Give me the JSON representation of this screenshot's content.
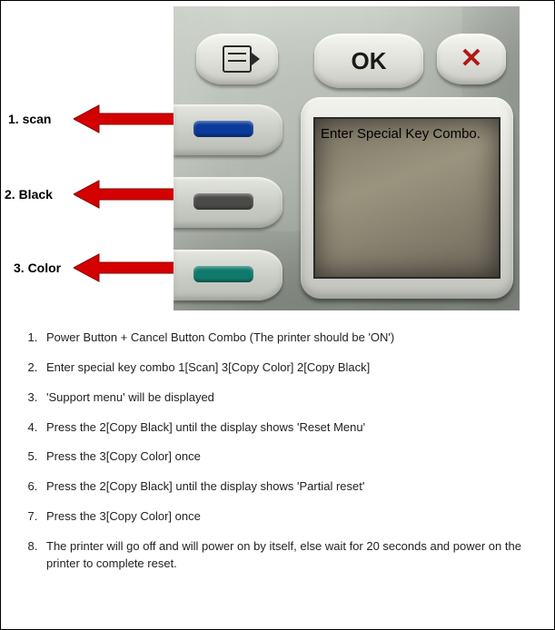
{
  "labels": {
    "scan": "1. scan",
    "black": "2. Black",
    "color": "3. Color"
  },
  "buttons": {
    "ok": "OK",
    "cancel_icon_name": "cancel-x-icon",
    "doc_icon_name": "document-icon"
  },
  "lcd_text": "Enter Special Key Combo.",
  "instructions": [
    "Power Button + Cancel Button Combo (The printer should be 'ON')",
    "Enter special key combo 1[Scan] 3[Copy Color] 2[Copy Black]",
    "'Support menu' will be displayed",
    "Press the 2[Copy Black] until the display shows 'Reset Menu'",
    "Press the 3[Copy Color] once",
    "Press the 2[Copy Black] until the display shows 'Partial reset'",
    "Press the 3[Copy Color] once",
    "The printer will go off and will power on by itself, else wait for 20 seconds and power on the printer to complete reset."
  ]
}
